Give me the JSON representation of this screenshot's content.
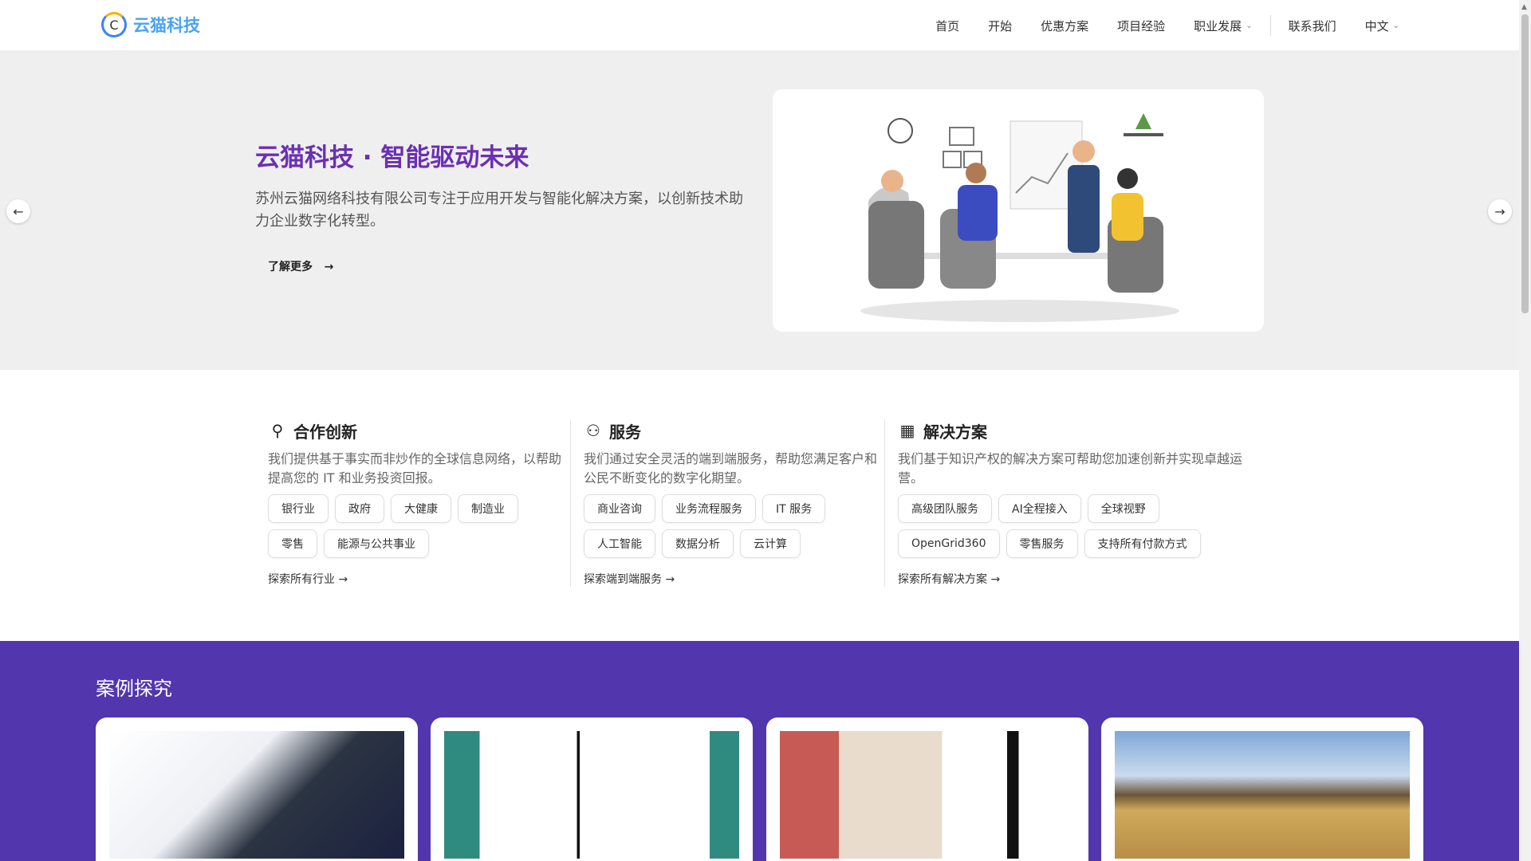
{
  "header": {
    "logo_letter": "C",
    "brand": "云猫科技",
    "nav": [
      {
        "label": "首页"
      },
      {
        "label": "开始"
      },
      {
        "label": "优惠方案"
      },
      {
        "label": "项目经验"
      },
      {
        "label": "职业发展",
        "dropdown": true
      },
      {
        "label": "联系我们"
      },
      {
        "label": "中文",
        "dropdown": true
      }
    ]
  },
  "hero": {
    "title": "云猫科技 · 智能驱动未来",
    "description": "苏州云猫网络科技有限公司专注于应用开发与智能化解决方案，以创新技术助力企业数字化转型。",
    "cta": "了解更多",
    "cta_arrow": "→",
    "prev": "←",
    "next": "→"
  },
  "features": [
    {
      "icon": "lightbulb-icon",
      "icon_glyph": "💡",
      "title": "合作创新",
      "description": "我们提供基于事实而非炒作的全球信息网络，以帮助提高您的 IT 和业务投资回报。",
      "tags": [
        "银行业",
        "政府",
        "大健康",
        "制造业",
        "零售",
        "能源与公共事业"
      ],
      "link": "探索所有行业 →"
    },
    {
      "icon": "users-icon",
      "icon_glyph": "👥",
      "title": "服务",
      "description": "我们通过安全灵活的端到端服务，帮助您满足客户和公民不断变化的数字化期望。",
      "tags": [
        "商业咨询",
        "业务流程服务",
        "IT 服务",
        "人工智能",
        "数据分析",
        "云计算"
      ],
      "link": "探索端到端服务 →"
    },
    {
      "icon": "grid-icon",
      "icon_glyph": "▦",
      "title": "解决方案",
      "description": "我们基于知识产权的解决方案可帮助您加速创新并实现卓越运营。",
      "tags": [
        "高级团队服务",
        "AI全程接入",
        "全球视野",
        "OpenGrid360",
        "零售服务",
        "支持所有付款方式"
      ],
      "link": "探索所有解决方案 →"
    }
  ],
  "cases": {
    "title": "案例探究"
  },
  "colors": {
    "brand": "#4aa3f0",
    "hero_title": "#6b2fb3",
    "cases_bg": "#5236ad"
  }
}
